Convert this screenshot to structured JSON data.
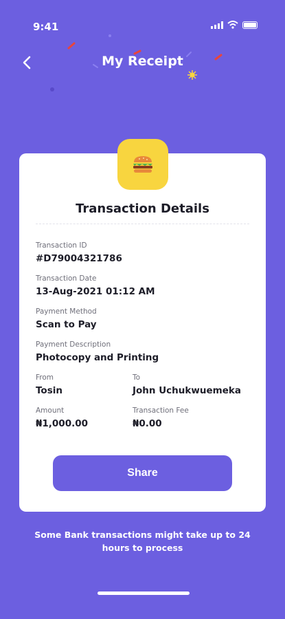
{
  "status": {
    "time": "9:41"
  },
  "header": {
    "title": "My Receipt"
  },
  "card": {
    "title": "Transaction Details",
    "fields": {
      "transaction_id": {
        "label": "Transaction ID",
        "value": "#D79004321786"
      },
      "transaction_date": {
        "label": "Transaction Date",
        "value": "13-Aug-2021 01:12 AM"
      },
      "payment_method": {
        "label": "Payment Method",
        "value": "Scan to Pay"
      },
      "payment_description": {
        "label": "Payment Description",
        "value": "Photocopy and Printing"
      },
      "from": {
        "label": "From",
        "value": "Tosin"
      },
      "to": {
        "label": "To",
        "value": "John Uchukwuemeka"
      },
      "amount": {
        "label": "Amount",
        "value": "₦1,000.00"
      },
      "transaction_fee": {
        "label": "Transaction Fee",
        "value": "₦0.00"
      }
    },
    "share_label": "Share"
  },
  "note": "Some Bank transactions might take up to 24 hours to process",
  "icons": {
    "back": "chevron-left-icon",
    "category": "burger-icon"
  },
  "colors": {
    "background": "#6c5fe0",
    "badge": "#f8d53f",
    "button": "#6c5fe0",
    "card": "#ffffff"
  }
}
